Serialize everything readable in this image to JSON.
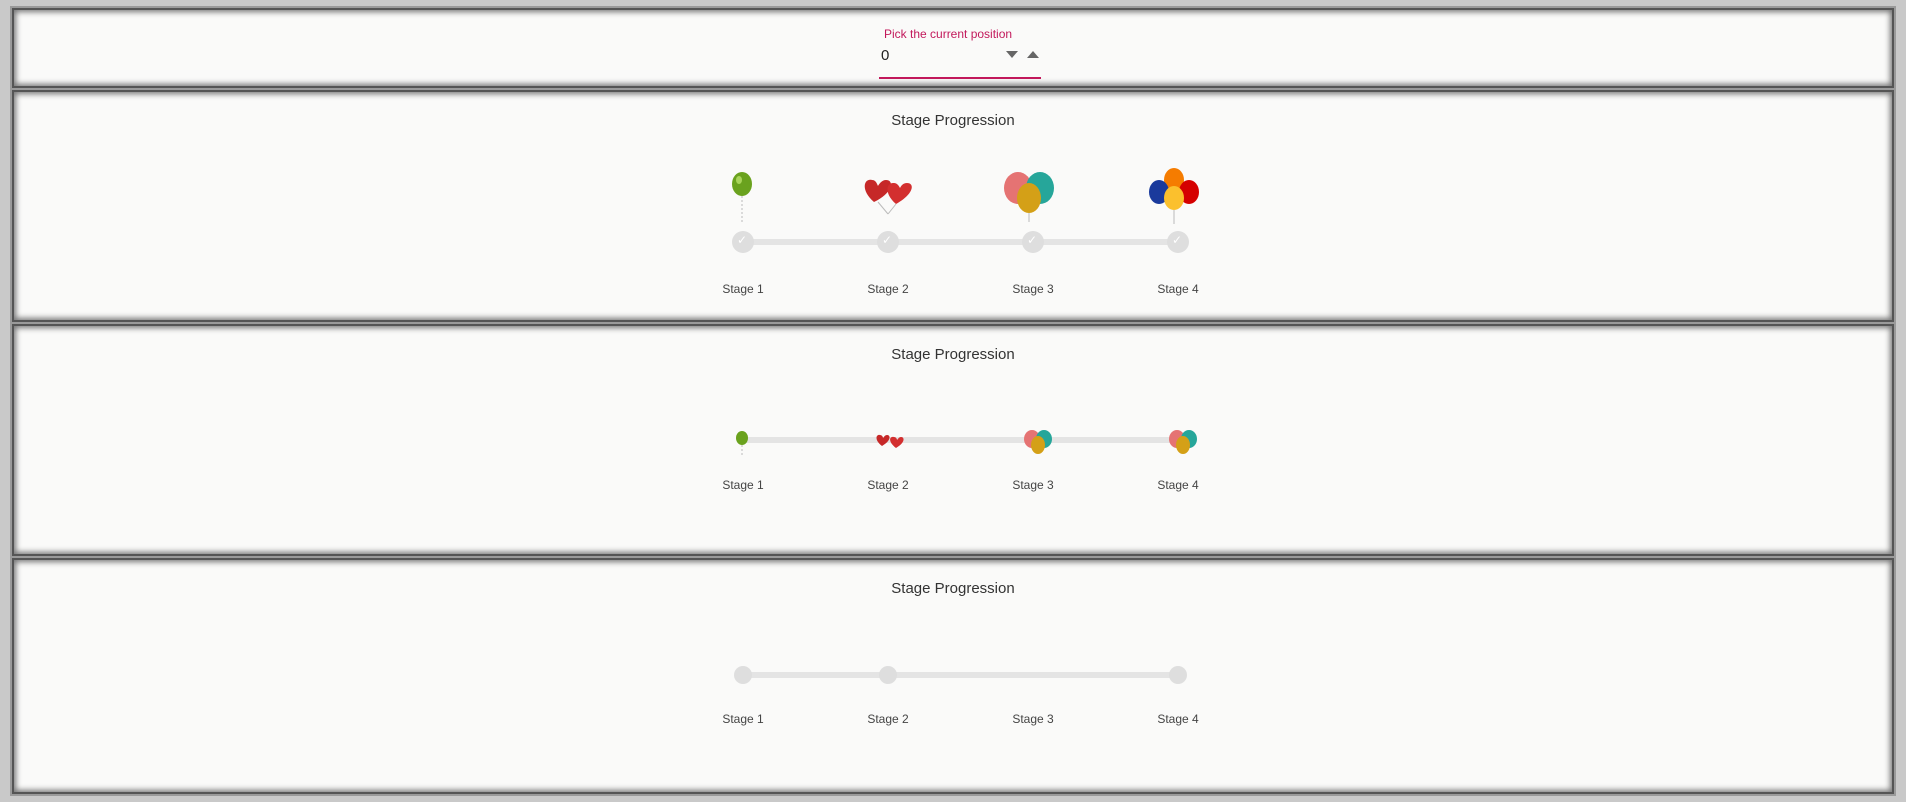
{
  "position_field": {
    "label": "Pick the current position",
    "value": "0"
  },
  "steppers": [
    {
      "title": "Stage Progression",
      "labels": [
        "Stage 1",
        "Stage 2",
        "Stage 3",
        "Stage 4"
      ],
      "icons": [
        "single-green-balloon-icon",
        "red-heart-balloons-icon",
        "multicolor-balloon-trio-icon",
        "balloon-bunch-icon"
      ],
      "checks": true
    },
    {
      "title": "Stage Progression",
      "labels": [
        "Stage 1",
        "Stage 2",
        "Stage 3",
        "Stage 4"
      ],
      "icons": [
        "single-green-balloon-icon",
        "red-heart-balloons-icon",
        "multicolor-balloon-trio-icon",
        "multicolor-balloon-trio-icon"
      ],
      "checks": false
    },
    {
      "title": "Stage Progression",
      "labels": [
        "Stage 1",
        "Stage 2",
        "Stage 3",
        "Stage 4"
      ],
      "icons": [],
      "checks": false
    }
  ],
  "colors": {
    "accent": "#c2185b",
    "track": "#e4e4e4",
    "step": "#dedede"
  }
}
